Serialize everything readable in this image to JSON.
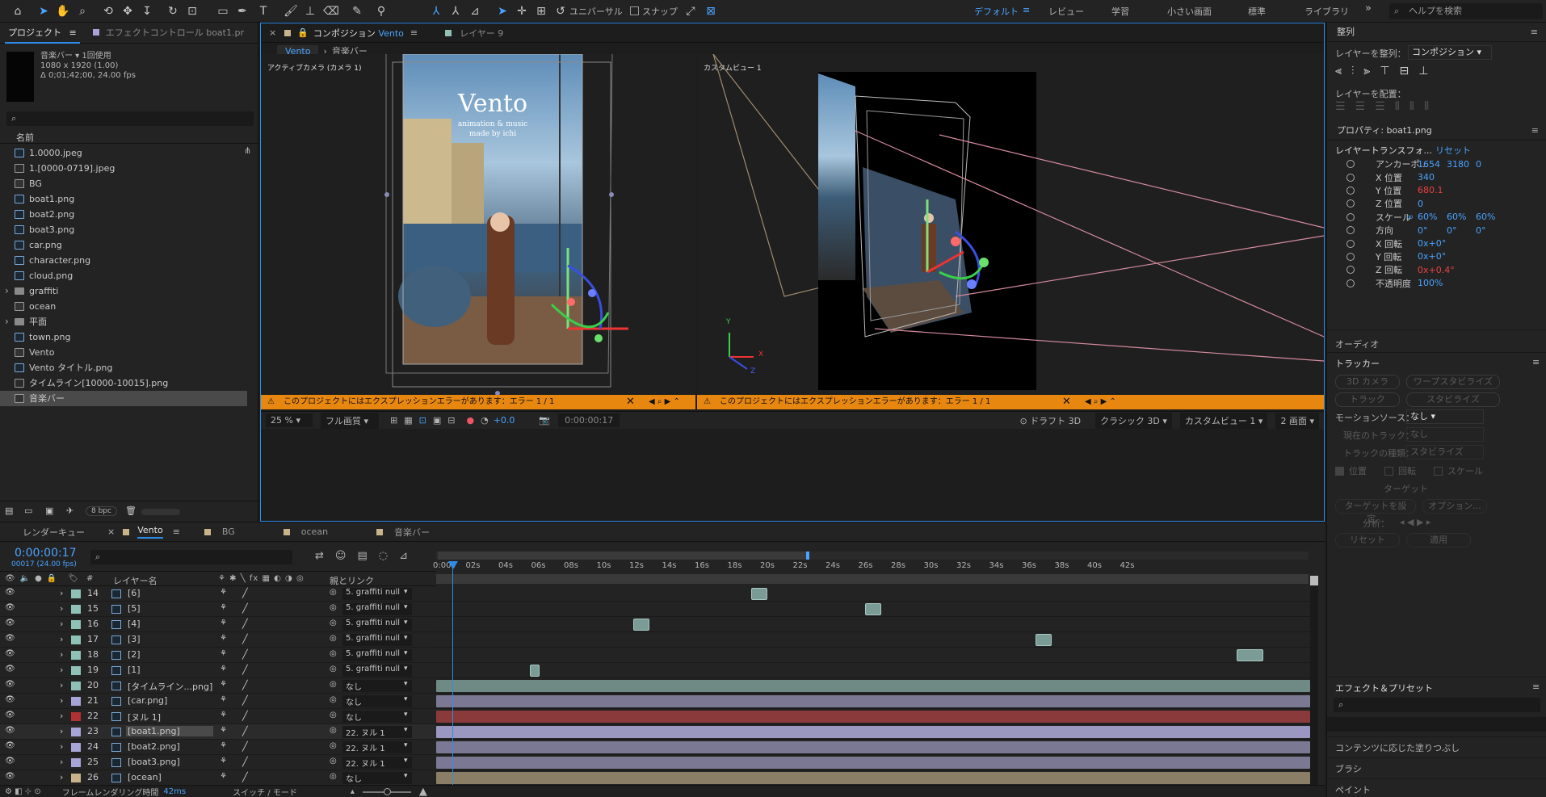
{
  "topbar": {
    "workspaces": [
      "デフォルト",
      "レビュー",
      "学習",
      "小さい画面",
      "標準",
      "ライブラリ"
    ],
    "active_workspace": "デフォルト",
    "help_placeholder": "ヘルプを検索",
    "universal": "ユニバーサル",
    "snap": "スナップ"
  },
  "project": {
    "tab": "プロジェクト",
    "effect_tab": "エフェクトコントロール boat1.pr",
    "selected_name": "音楽バー ▾",
    "used": "1回使用",
    "res": "1080 x 1920 (1.00)",
    "duration": "Δ 0;01;42;00, 24.00 fps",
    "column_name": "名前",
    "bpc": "8 bpc",
    "files": [
      {
        "name": "1.0000.jpeg",
        "t": "img"
      },
      {
        "name": "1.[0000-0719].jpeg",
        "t": "seq"
      },
      {
        "name": "BG",
        "t": "comp"
      },
      {
        "name": "boat1.png",
        "t": "img"
      },
      {
        "name": "boat2.png",
        "t": "img"
      },
      {
        "name": "boat3.png",
        "t": "img"
      },
      {
        "name": "car.png",
        "t": "img"
      },
      {
        "name": "character.png",
        "t": "img"
      },
      {
        "name": "cloud.png",
        "t": "img"
      },
      {
        "name": "graffiti",
        "t": "folder"
      },
      {
        "name": "ocean",
        "t": "comp"
      },
      {
        "name": "平面",
        "t": "folder"
      },
      {
        "name": "town.png",
        "t": "img"
      },
      {
        "name": "Vento",
        "t": "comp"
      },
      {
        "name": "Vento タイトル.png",
        "t": "img"
      },
      {
        "name": "タイムライン[10000-10015].png",
        "t": "seq"
      },
      {
        "name": "音楽バー",
        "t": "comp"
      }
    ]
  },
  "comp": {
    "tab": "コンポジション",
    "tab_name": "Vento",
    "layer_tab": "レイヤー 9",
    "crumbs": [
      "Vento",
      "音楽バー"
    ],
    "view1_label": "アクティブカメラ (カメラ 1)",
    "view2_label": "カスタムビュー 1",
    "poster_title": "Vento",
    "poster_sub1": "animation & music",
    "poster_sub2": "made by ichi",
    "error_text": "このプロジェクトにはエクスプレッションエラーがあります：エラー 1 / 1",
    "zoom": "25 %",
    "quality": "フル画質",
    "exposure": "+0.0",
    "timecode": "0:00:00:17",
    "draft": "ドラフト 3D",
    "renderer": "クラシック 3D",
    "view_mode": "カスタムビュー 1",
    "layout": "2 画面",
    "axis_x": "X",
    "axis_y": "Y",
    "axis_z": "Z"
  },
  "right": {
    "align_title": "整列",
    "align_to_label": "レイヤーを整列：",
    "align_to_value": "コンポジション",
    "distribute_label": "レイヤーを配置：",
    "props_title": "プロパティ: boat1.png",
    "transform": "レイヤートランスフォ...",
    "reset": "リセット",
    "props": [
      {
        "label": "アンカーポ...",
        "v1": "1654",
        "v2": "3180",
        "v3": "0",
        "red": false
      },
      {
        "label": "X 位置",
        "v1": "340",
        "v2": "",
        "v3": "",
        "red": false
      },
      {
        "label": "Y 位置",
        "v1": "680.1",
        "v2": "",
        "v3": "",
        "red": true
      },
      {
        "label": "Z 位置",
        "v1": "0",
        "v2": "",
        "v3": "",
        "red": false
      },
      {
        "label": "スケール",
        "v1": "60%",
        "v2": "60%",
        "v3": "60%",
        "red": false
      },
      {
        "label": "方向",
        "v1": "0°",
        "v2": "0°",
        "v3": "0°",
        "red": false
      },
      {
        "label": "X 回転",
        "v1": "0x+0°",
        "v2": "",
        "v3": "",
        "red": false
      },
      {
        "label": "Y 回転",
        "v1": "0x+0°",
        "v2": "",
        "v3": "",
        "red": false
      },
      {
        "label": "Z 回転",
        "v1": "0x+0.4°",
        "v2": "",
        "v3": "",
        "red": true
      },
      {
        "label": "不透明度",
        "v1": "100%",
        "v2": "",
        "v3": "",
        "red": false
      }
    ],
    "audio": "オーディオ",
    "tracker": "トラッカー",
    "track_cam": "3D カメラ",
    "warp": "ワープスタビライズ",
    "track": "トラック",
    "stabilize": "スタビライズ",
    "motion_src_label": "モーションソース：",
    "motion_src": "なし",
    "current_track_label": "現在のトラック：",
    "current_track": "なし",
    "track_type_label": "トラックの種類：",
    "track_type": "スタビライズ",
    "pos": "位置",
    "rot": "回転",
    "scale": "スケール",
    "target": "ターゲット",
    "set_target": "ターゲットを設定...",
    "options": "オプション...",
    "analyze": "分析：",
    "reset_btn": "リセット",
    "apply": "適用",
    "effects_title": "エフェクト＆プリセット",
    "content_fill": "コンテンツに応じた塗りつぶし",
    "brush": "ブラシ",
    "paint": "ペイント"
  },
  "timeline": {
    "tabs": [
      "レンダーキュー",
      "Vento",
      "BG",
      "ocean",
      "音楽バー"
    ],
    "active_tab": "Vento",
    "timecode": "0:00:00:17",
    "timecode_sub": "00017 (24.00 fps)",
    "col_layer": "レイヤー名",
    "col_parent": "親とリンク",
    "footer_render": "フレームレンダリング時間",
    "footer_time": "42ms",
    "footer_switch": "スイッチ / モード",
    "ruler": [
      "0:00s",
      "02s",
      "04s",
      "06s",
      "08s",
      "10s",
      "12s",
      "14s",
      "16s",
      "18s",
      "20s",
      "22s",
      "24s",
      "26s",
      "28s",
      "30s",
      "32s",
      "34s",
      "36s",
      "38s",
      "40s",
      "42s"
    ],
    "layers": [
      {
        "num": "14",
        "name": "[6]",
        "parent": "5. graffiti null",
        "color": "#8fc1b7",
        "sel": false,
        "bar": "#7b9b96",
        "start": 15.5,
        "end": 16.3,
        "full": false
      },
      {
        "num": "15",
        "name": "[5]",
        "parent": "5. graffiti null",
        "color": "#8fc1b7",
        "sel": false,
        "bar": "#7b9b96",
        "start": 21.1,
        "end": 21.9,
        "full": false
      },
      {
        "num": "16",
        "name": "[4]",
        "parent": "5. graffiti null",
        "color": "#8fc1b7",
        "sel": false,
        "bar": "#7b9b96",
        "start": 9.7,
        "end": 10.5,
        "full": false
      },
      {
        "num": "17",
        "name": "[3]",
        "parent": "5. graffiti null",
        "color": "#8fc1b7",
        "sel": false,
        "bar": "#7b9b96",
        "start": 29.5,
        "end": 30.3,
        "full": false
      },
      {
        "num": "18",
        "name": "[2]",
        "parent": "5. graffiti null",
        "color": "#8fc1b7",
        "sel": false,
        "bar": "#7b9b96",
        "start": 39.4,
        "end": 40.7,
        "full": false
      },
      {
        "num": "19",
        "name": "[1]",
        "parent": "5. graffiti null",
        "color": "#8fc1b7",
        "sel": false,
        "bar": "#7b9b96",
        "start": 4.6,
        "end": 5.1,
        "full": false
      },
      {
        "num": "20",
        "name": "[タイムライン...png]",
        "parent": "なし",
        "color": "#8fc1b7",
        "sel": false,
        "bar": "#6f8a85",
        "start": 0,
        "end": 43,
        "full": true
      },
      {
        "num": "21",
        "name": "[car.png]",
        "parent": "なし",
        "color": "#a7a4d8",
        "sel": false,
        "bar": "#7a7892",
        "start": 0,
        "end": 43,
        "full": true
      },
      {
        "num": "22",
        "name": "[ヌル 1]",
        "parent": "なし",
        "color": "#b03232",
        "sel": false,
        "bar": "#8a3a3a",
        "start": 0,
        "end": 43,
        "full": true
      },
      {
        "num": "23",
        "name": "[boat1.png]",
        "parent": "22. ヌル 1",
        "color": "#a7a4d8",
        "sel": true,
        "bar": "#8e8bb3",
        "start": 0,
        "end": 43,
        "full": true
      },
      {
        "num": "24",
        "name": "[boat2.png]",
        "parent": "22. ヌル 1",
        "color": "#a7a4d8",
        "sel": false,
        "bar": "#7a7892",
        "start": 0,
        "end": 43,
        "full": true
      },
      {
        "num": "25",
        "name": "[boat3.png]",
        "parent": "22. ヌル 1",
        "color": "#a7a4d8",
        "sel": false,
        "bar": "#7a7892",
        "start": 0,
        "end": 43,
        "full": true
      },
      {
        "num": "26",
        "name": "[ocean]",
        "parent": "なし",
        "color": "#c9b38b",
        "sel": false,
        "bar": "#8a7f66",
        "start": 0,
        "end": 43,
        "full": true
      }
    ]
  }
}
